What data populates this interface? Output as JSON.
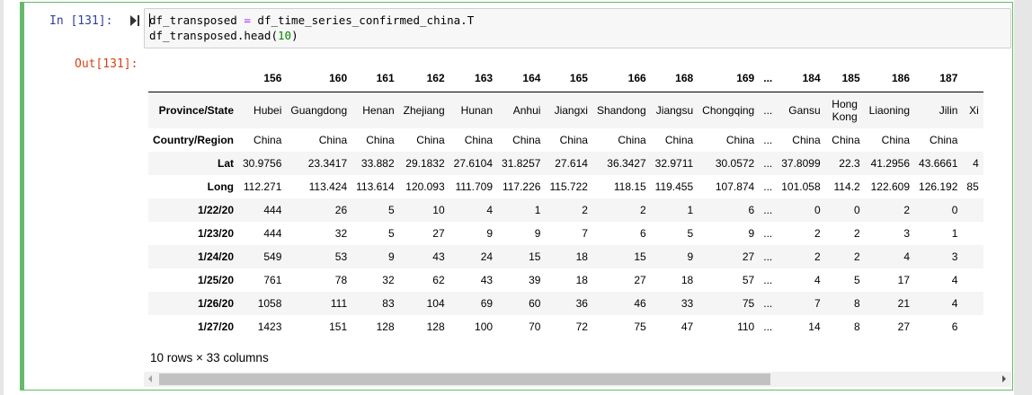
{
  "cell": {
    "in_prompt": "In [131]:",
    "out_prompt": "Out[131]:",
    "code_line1_a": "df_transposed ",
    "code_line1_op": "=",
    "code_line1_b": " df_time_series_confirmed_china.T",
    "code_line2_a": "df_transposed.head(",
    "code_line2_num": "10",
    "code_line2_b": ")"
  },
  "table": {
    "columns": [
      "156",
      "160",
      "161",
      "162",
      "163",
      "164",
      "165",
      "166",
      "168",
      "169",
      "...",
      "184",
      "185",
      "186",
      "187",
      ""
    ],
    "rows": [
      {
        "label": "Province/State",
        "values": [
          "Hubei",
          "Guangdong",
          "Henan",
          "Zhejiang",
          "Hunan",
          "Anhui",
          "Jiangxi",
          "Shandong",
          "Jiangsu",
          "Chongqing",
          "...",
          "Gansu",
          "Hong Kong",
          "Liaoning",
          "Jilin",
          "Xi"
        ]
      },
      {
        "label": "Country/Region",
        "values": [
          "China",
          "China",
          "China",
          "China",
          "China",
          "China",
          "China",
          "China",
          "China",
          "China",
          "...",
          "China",
          "China",
          "China",
          "China",
          ""
        ]
      },
      {
        "label": "Lat",
        "values": [
          "30.9756",
          "23.3417",
          "33.882",
          "29.1832",
          "27.6104",
          "31.8257",
          "27.614",
          "36.3427",
          "32.9711",
          "30.0572",
          "...",
          "37.8099",
          "22.3",
          "41.2956",
          "43.6661",
          "4"
        ]
      },
      {
        "label": "Long",
        "values": [
          "112.271",
          "113.424",
          "113.614",
          "120.093",
          "111.709",
          "117.226",
          "115.722",
          "118.15",
          "119.455",
          "107.874",
          "...",
          "101.058",
          "114.2",
          "122.609",
          "126.192",
          "85"
        ]
      },
      {
        "label": "1/22/20",
        "values": [
          "444",
          "26",
          "5",
          "10",
          "4",
          "1",
          "2",
          "2",
          "1",
          "6",
          "...",
          "0",
          "0",
          "2",
          "0",
          ""
        ]
      },
      {
        "label": "1/23/20",
        "values": [
          "444",
          "32",
          "5",
          "27",
          "9",
          "9",
          "7",
          "6",
          "5",
          "9",
          "...",
          "2",
          "2",
          "3",
          "1",
          ""
        ]
      },
      {
        "label": "1/24/20",
        "values": [
          "549",
          "53",
          "9",
          "43",
          "24",
          "15",
          "18",
          "15",
          "9",
          "27",
          "...",
          "2",
          "2",
          "4",
          "3",
          ""
        ]
      },
      {
        "label": "1/25/20",
        "values": [
          "761",
          "78",
          "32",
          "62",
          "43",
          "39",
          "18",
          "27",
          "18",
          "57",
          "...",
          "4",
          "5",
          "17",
          "4",
          ""
        ]
      },
      {
        "label": "1/26/20",
        "values": [
          "1058",
          "111",
          "83",
          "104",
          "69",
          "60",
          "36",
          "46",
          "33",
          "75",
          "...",
          "7",
          "8",
          "21",
          "4",
          ""
        ]
      },
      {
        "label": "1/27/20",
        "values": [
          "1423",
          "151",
          "128",
          "128",
          "100",
          "70",
          "72",
          "75",
          "47",
          "110",
          "...",
          "14",
          "8",
          "27",
          "6",
          ""
        ]
      }
    ]
  },
  "footer": "10 rows × 33 columns",
  "scrollbar": {
    "thumb_fraction": 0.73
  },
  "colors": {
    "cell_border": "#66bb6a",
    "in_prompt": "#303f9f",
    "out_prompt": "#d84315"
  }
}
